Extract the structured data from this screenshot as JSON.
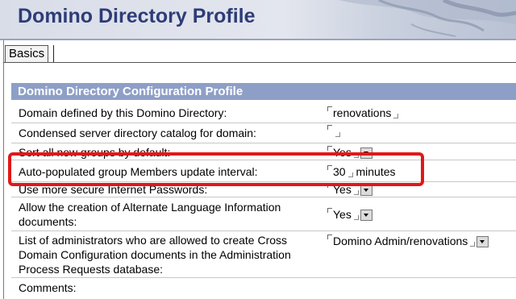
{
  "header": {
    "title": "Domino Directory Profile"
  },
  "tabs": [
    {
      "label": "Basics"
    }
  ],
  "section": {
    "title": "Domino Directory Configuration Profile"
  },
  "fields": [
    {
      "label": "Domain defined by this Domino Directory:",
      "value": "renovations"
    },
    {
      "label": "Condensed server directory catalog for domain:",
      "value": ""
    },
    {
      "label": "Sort all new groups by default:",
      "value": "Yes"
    },
    {
      "label": "Auto-populated group Members update interval:",
      "value": "30",
      "unit": "minutes"
    },
    {
      "label": "Use more secure Internet Passwords:",
      "value": "Yes"
    },
    {
      "label": "Allow the creation of Alternate Language Information documents:",
      "value": "Yes"
    },
    {
      "label": "List of administrators who are allowed to create Cross Domain Configuration documents in the Administration Process Requests database:",
      "value": "Domino Admin/renovations"
    },
    {
      "label": "Comments:",
      "value": ""
    }
  ],
  "annotation": {
    "color": "#e01818"
  }
}
